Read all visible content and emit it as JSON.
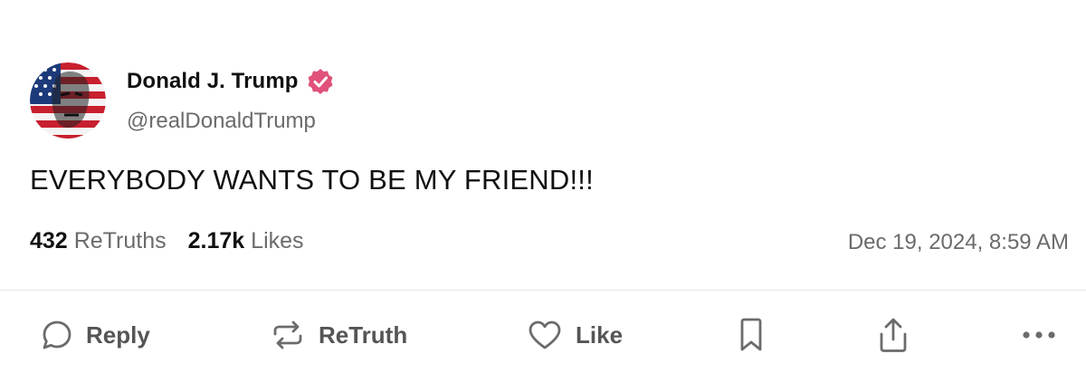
{
  "post": {
    "display_name": "Donald J. Trump",
    "handle": "@realDonaldTrump",
    "content": "EVERYBODY WANTS TO BE MY FRIEND!!!",
    "retruths_count": "432",
    "retruths_label": "ReTruths",
    "likes_count": "2.17k",
    "likes_label": "Likes",
    "timestamp": "Dec 19, 2024, 8:59 AM"
  },
  "actions": {
    "reply_label": "Reply",
    "retruth_label": "ReTruth",
    "like_label": "Like"
  },
  "icons": [
    "verified-badge-icon",
    "reply-icon",
    "retruth-icon",
    "like-icon",
    "bookmark-icon",
    "share-icon",
    "more-icon"
  ],
  "colors": {
    "verified_badge": "#e0527a",
    "text_primary": "#111111",
    "text_secondary": "#6b6b6b",
    "divider": "#e4e4e4"
  }
}
